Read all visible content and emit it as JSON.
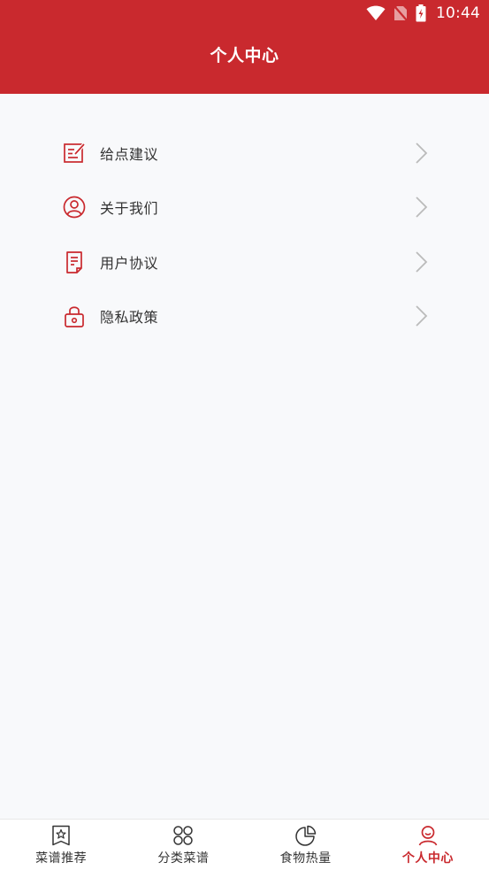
{
  "colors": {
    "primary": "#c9292e",
    "background": "#f8f9fb",
    "text": "#333333",
    "chevron": "#bbbbbb",
    "tab_inactive": "#333333"
  },
  "status_bar": {
    "time": "10:44",
    "icons": [
      "wifi-icon",
      "no-sim-icon",
      "battery-charging-icon"
    ]
  },
  "header": {
    "title": "个人中心"
  },
  "menu": {
    "items": [
      {
        "label": "给点建议",
        "icon": "feedback-edit-icon"
      },
      {
        "label": "关于我们",
        "icon": "user-circle-icon"
      },
      {
        "label": "用户协议",
        "icon": "document-icon"
      },
      {
        "label": "隐私政策",
        "icon": "lock-icon"
      }
    ]
  },
  "tabbar": {
    "tabs": [
      {
        "label": "菜谱推荐",
        "icon": "bookmark-star-icon",
        "active": false
      },
      {
        "label": "分类菜谱",
        "icon": "category-grid-icon",
        "active": false
      },
      {
        "label": "食物热量",
        "icon": "pie-chart-icon",
        "active": false
      },
      {
        "label": "个人中心",
        "icon": "person-icon",
        "active": true
      }
    ]
  }
}
